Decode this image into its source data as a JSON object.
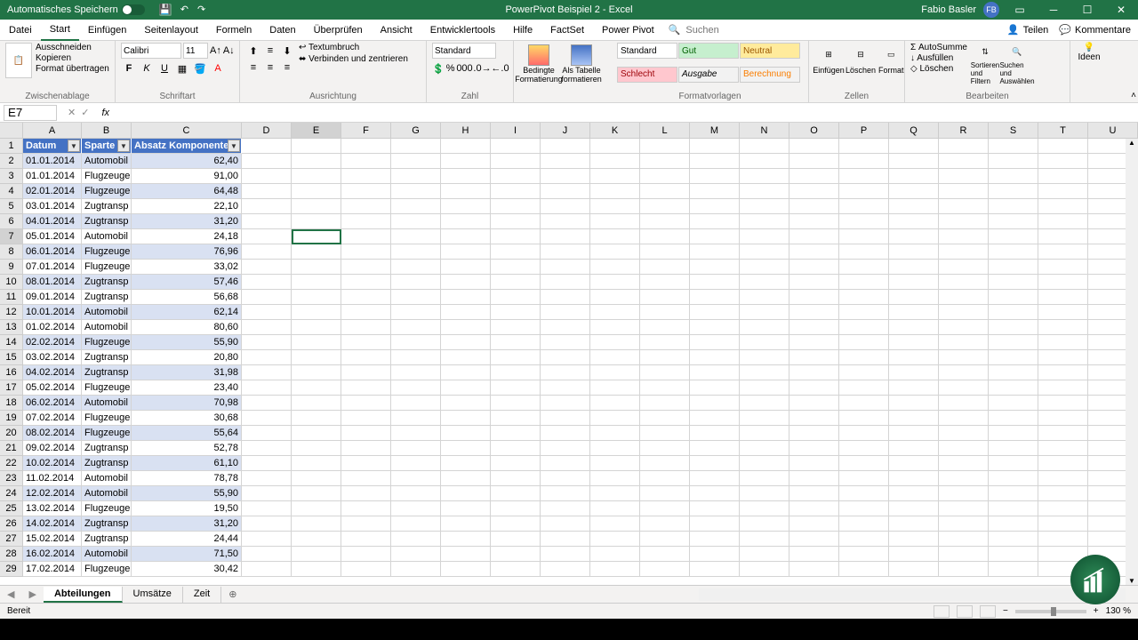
{
  "title_bar": {
    "autosave_label": "Automatisches Speichern",
    "doc_title": "PowerPivot Beispiel 2 - Excel",
    "user_name": "Fabio Basler",
    "user_initials": "FB"
  },
  "tabs": {
    "items": [
      "Datei",
      "Start",
      "Einfügen",
      "Seitenlayout",
      "Formeln",
      "Daten",
      "Überprüfen",
      "Ansicht",
      "Entwicklertools",
      "Hilfe",
      "FactSet",
      "Power Pivot"
    ],
    "active": "Start",
    "search_placeholder": "Suchen",
    "share": "Teilen",
    "comments": "Kommentare"
  },
  "ribbon": {
    "clipboard": {
      "label": "Zwischenablage",
      "cut": "Ausschneiden",
      "copy": "Kopieren",
      "format": "Format übertragen"
    },
    "font": {
      "label": "Schriftart",
      "name": "Calibri",
      "size": "11"
    },
    "align": {
      "label": "Ausrichtung",
      "wrap": "Textumbruch",
      "merge": "Verbinden und zentrieren"
    },
    "number": {
      "label": "Zahl",
      "format": "Standard"
    },
    "cond": {
      "cond_label": "Bedingte Formatierung",
      "table_label": "Als Tabelle formatieren"
    },
    "styles": {
      "label": "Formatvorlagen",
      "standard": "Standard",
      "gut": "Gut",
      "neutral": "Neutral",
      "schlecht": "Schlecht",
      "ausgabe": "Ausgabe",
      "berechnung": "Berechnung"
    },
    "cells": {
      "label": "Zellen",
      "insert": "Einfügen",
      "delete": "Löschen",
      "format": "Format"
    },
    "edit": {
      "label": "Bearbeiten",
      "autosum": "AutoSumme",
      "fill": "Ausfüllen",
      "clear": "Löschen",
      "sort": "Sortieren und Filtern",
      "find": "Suchen und Auswählen"
    },
    "ideas": {
      "label": "Ideen"
    }
  },
  "formula": {
    "name_box": "E7",
    "fx": "fx"
  },
  "columns": [
    "A",
    "B",
    "C",
    "D",
    "E",
    "F",
    "G",
    "H",
    "I",
    "J",
    "K",
    "L",
    "M",
    "N",
    "O",
    "P",
    "Q",
    "R",
    "S",
    "T",
    "U"
  ],
  "headers": {
    "A": "Datum",
    "B": "Sparte",
    "C": "Absatz Komponenten"
  },
  "rows": [
    {
      "n": 2,
      "A": "01.01.2014",
      "B": "Automobil",
      "C": "62,40"
    },
    {
      "n": 3,
      "A": "01.01.2014",
      "B": "Flugzeuge",
      "C": "91,00"
    },
    {
      "n": 4,
      "A": "02.01.2014",
      "B": "Flugzeuge",
      "C": "64,48"
    },
    {
      "n": 5,
      "A": "03.01.2014",
      "B": "Zugtransp",
      "C": "22,10"
    },
    {
      "n": 6,
      "A": "04.01.2014",
      "B": "Zugtransp",
      "C": "31,20"
    },
    {
      "n": 7,
      "A": "05.01.2014",
      "B": "Automobil",
      "C": "24,18"
    },
    {
      "n": 8,
      "A": "06.01.2014",
      "B": "Flugzeuge",
      "C": "76,96"
    },
    {
      "n": 9,
      "A": "07.01.2014",
      "B": "Flugzeuge",
      "C": "33,02"
    },
    {
      "n": 10,
      "A": "08.01.2014",
      "B": "Zugtransp",
      "C": "57,46"
    },
    {
      "n": 11,
      "A": "09.01.2014",
      "B": "Zugtransp",
      "C": "56,68"
    },
    {
      "n": 12,
      "A": "10.01.2014",
      "B": "Automobil",
      "C": "62,14"
    },
    {
      "n": 13,
      "A": "01.02.2014",
      "B": "Automobil",
      "C": "80,60"
    },
    {
      "n": 14,
      "A": "02.02.2014",
      "B": "Flugzeuge",
      "C": "55,90"
    },
    {
      "n": 15,
      "A": "03.02.2014",
      "B": "Zugtransp",
      "C": "20,80"
    },
    {
      "n": 16,
      "A": "04.02.2014",
      "B": "Zugtransp",
      "C": "31,98"
    },
    {
      "n": 17,
      "A": "05.02.2014",
      "B": "Flugzeuge",
      "C": "23,40"
    },
    {
      "n": 18,
      "A": "06.02.2014",
      "B": "Automobil",
      "C": "70,98"
    },
    {
      "n": 19,
      "A": "07.02.2014",
      "B": "Flugzeuge",
      "C": "30,68"
    },
    {
      "n": 20,
      "A": "08.02.2014",
      "B": "Flugzeuge",
      "C": "55,64"
    },
    {
      "n": 21,
      "A": "09.02.2014",
      "B": "Zugtransp",
      "C": "52,78"
    },
    {
      "n": 22,
      "A": "10.02.2014",
      "B": "Zugtransp",
      "C": "61,10"
    },
    {
      "n": 23,
      "A": "11.02.2014",
      "B": "Automobil",
      "C": "78,78"
    },
    {
      "n": 24,
      "A": "12.02.2014",
      "B": "Automobil",
      "C": "55,90"
    },
    {
      "n": 25,
      "A": "13.02.2014",
      "B": "Flugzeuge",
      "C": "19,50"
    },
    {
      "n": 26,
      "A": "14.02.2014",
      "B": "Zugtransp",
      "C": "31,20"
    },
    {
      "n": 27,
      "A": "15.02.2014",
      "B": "Zugtransp",
      "C": "24,44"
    },
    {
      "n": 28,
      "A": "16.02.2014",
      "B": "Automobil",
      "C": "71,50"
    },
    {
      "n": 29,
      "A": "17.02.2014",
      "B": "Flugzeuge",
      "C": "30,42"
    }
  ],
  "selected_cell": "E7",
  "sheets": {
    "items": [
      "Abteilungen",
      "Umsätze",
      "Zeit"
    ],
    "active": "Abteilungen"
  },
  "status": {
    "ready": "Bereit",
    "zoom": "130 %"
  }
}
